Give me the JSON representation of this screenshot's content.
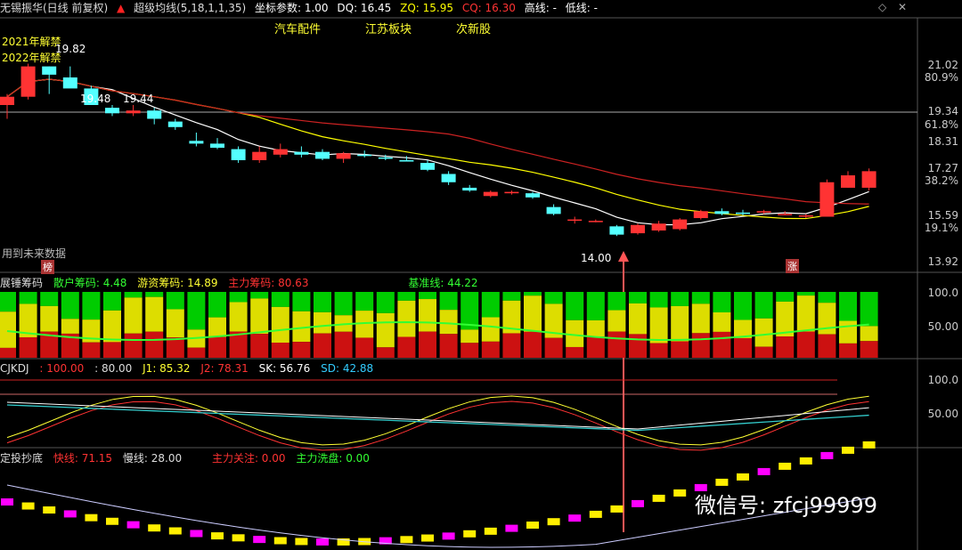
{
  "header": {
    "stock": "无锡振华(日线 前复权)",
    "indicator": "超级均线(5,18,1,1,35)",
    "coord": "坐标参数: 1.00",
    "dq": "DQ: 16.45",
    "zq": "ZQ: 15.95",
    "cq": "CQ: 16.30",
    "high": "高线: -",
    "low": "低线: -",
    "tags": [
      "汽车配件",
      "江苏板块",
      "次新股"
    ]
  },
  "annotations": {
    "forecast_2021": "2021年解禁",
    "forecast_2022": "2022年解禁",
    "label_1982": "19.82",
    "label_1948": "19.48",
    "label_1944": "19.44",
    "label_1400": "14.00",
    "future_data": "用到未来数据",
    "bang": "榜",
    "zhang": "涨",
    "wechat": "微信号: zfcj99999"
  },
  "axes": {
    "main_ticks": [
      "21.02",
      "80.9%",
      "19.34",
      "61.8%",
      "18.31",
      "17.27",
      "38.2%",
      "15.59",
      "19.1%",
      "13.92"
    ],
    "panel2_ticks": [
      "100.0",
      "50.00"
    ],
    "panel3_ticks": [
      "100.0",
      "50.00"
    ]
  },
  "panel2": {
    "title": "展锤筹码",
    "retail": "散户筹码: 4.48",
    "hot": "游资筹码: 14.89",
    "main": "主力筹码: 80.63",
    "base": "基准线: 44.22"
  },
  "panel3": {
    "title": "CJKDJ",
    "v1": ": 100.00",
    "v2": ": 80.00",
    "j1": "J1: 85.32",
    "j2": "J2: 78.31",
    "sk": "SK: 56.76",
    "sd": "SD: 42.88"
  },
  "panel4": {
    "title": "定投抄底",
    "fast": "快线: 71.15",
    "slow": "慢线: 28.00",
    "focus": "主力关注: 0.00",
    "wash": "主力洗盘: 0.00"
  },
  "colors": {
    "up": "#ff3333",
    "down": "#54ffff",
    "ma_white": "#ffffff",
    "ma_yellow": "#ffff00",
    "ma_red": "#cc2222",
    "magenta": "#ff00ff"
  },
  "chart_data": {
    "type": "candlestick",
    "ylim": [
      13.92,
      21.02
    ],
    "candles": [
      {
        "o": 19.6,
        "h": 20.0,
        "l": 19.1,
        "c": 19.9
      },
      {
        "o": 19.9,
        "h": 21.1,
        "l": 19.8,
        "c": 21.0
      },
      {
        "o": 21.0,
        "h": 21.0,
        "l": 20.0,
        "c": 20.7
      },
      {
        "o": 20.6,
        "h": 21.0,
        "l": 20.4,
        "c": 20.2
      },
      {
        "o": 20.2,
        "h": 20.3,
        "l": 19.6,
        "c": 19.6
      },
      {
        "o": 19.5,
        "h": 19.6,
        "l": 19.2,
        "c": 19.3
      },
      {
        "o": 19.3,
        "h": 19.6,
        "l": 19.2,
        "c": 19.4
      },
      {
        "o": 19.4,
        "h": 19.5,
        "l": 18.9,
        "c": 19.1
      },
      {
        "o": 19.0,
        "h": 19.1,
        "l": 18.7,
        "c": 18.8
      },
      {
        "o": 18.3,
        "h": 18.6,
        "l": 18.1,
        "c": 18.2
      },
      {
        "o": 18.2,
        "h": 18.4,
        "l": 18.0,
        "c": 18.05
      },
      {
        "o": 18.0,
        "h": 18.1,
        "l": 17.5,
        "c": 17.6
      },
      {
        "o": 17.6,
        "h": 18.1,
        "l": 17.5,
        "c": 17.9
      },
      {
        "o": 17.8,
        "h": 18.2,
        "l": 17.7,
        "c": 18.0
      },
      {
        "o": 17.9,
        "h": 18.1,
        "l": 17.7,
        "c": 17.8
      },
      {
        "o": 17.9,
        "h": 18.0,
        "l": 17.6,
        "c": 17.65
      },
      {
        "o": 17.65,
        "h": 17.9,
        "l": 17.5,
        "c": 17.85
      },
      {
        "o": 17.8,
        "h": 17.95,
        "l": 17.7,
        "c": 17.75
      },
      {
        "o": 17.7,
        "h": 17.8,
        "l": 17.6,
        "c": 17.65
      },
      {
        "o": 17.6,
        "h": 17.75,
        "l": 17.55,
        "c": 17.55
      },
      {
        "o": 17.5,
        "h": 17.6,
        "l": 17.2,
        "c": 17.25
      },
      {
        "o": 17.1,
        "h": 17.2,
        "l": 16.7,
        "c": 16.8
      },
      {
        "o": 16.6,
        "h": 16.7,
        "l": 16.45,
        "c": 16.5
      },
      {
        "o": 16.3,
        "h": 16.5,
        "l": 16.25,
        "c": 16.45
      },
      {
        "o": 16.4,
        "h": 16.5,
        "l": 16.35,
        "c": 16.45
      },
      {
        "o": 16.4,
        "h": 16.45,
        "l": 16.2,
        "c": 16.25
      },
      {
        "o": 15.9,
        "h": 16.0,
        "l": 15.6,
        "c": 15.65
      },
      {
        "o": 15.45,
        "h": 15.55,
        "l": 15.3,
        "c": 15.45
      },
      {
        "o": 15.4,
        "h": 15.45,
        "l": 15.35,
        "c": 15.4
      },
      {
        "o": 15.2,
        "h": 15.25,
        "l": 14.85,
        "c": 14.9
      },
      {
        "o": 14.95,
        "h": 15.3,
        "l": 14.9,
        "c": 15.25
      },
      {
        "o": 15.05,
        "h": 15.4,
        "l": 15.0,
        "c": 15.3
      },
      {
        "o": 15.1,
        "h": 15.5,
        "l": 15.05,
        "c": 15.45
      },
      {
        "o": 15.5,
        "h": 15.8,
        "l": 15.45,
        "c": 15.75
      },
      {
        "o": 15.75,
        "h": 15.85,
        "l": 15.6,
        "c": 15.65
      },
      {
        "o": 15.7,
        "h": 15.8,
        "l": 15.6,
        "c": 15.65
      },
      {
        "o": 15.7,
        "h": 15.8,
        "l": 15.65,
        "c": 15.75
      },
      {
        "o": 15.65,
        "h": 15.75,
        "l": 15.6,
        "c": 15.65
      },
      {
        "o": 15.55,
        "h": 15.65,
        "l": 15.5,
        "c": 15.6
      },
      {
        "o": 15.55,
        "h": 16.9,
        "l": 15.55,
        "c": 16.8
      },
      {
        "o": 16.6,
        "h": 17.2,
        "l": 16.6,
        "c": 17.05
      },
      {
        "o": 16.6,
        "h": 17.3,
        "l": 16.5,
        "c": 17.2
      }
    ]
  }
}
